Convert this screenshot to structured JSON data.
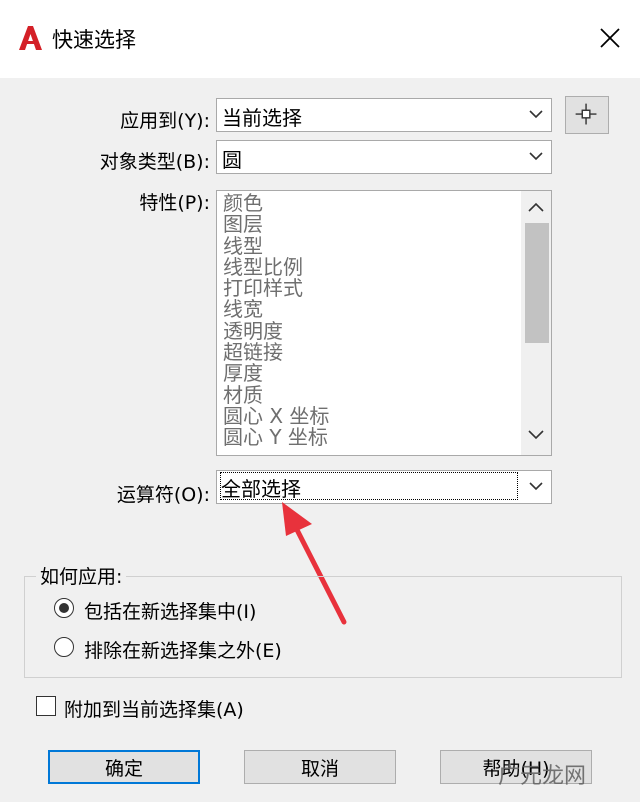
{
  "window": {
    "title": "快速选择"
  },
  "apply_to": {
    "label": "应用到(Y):",
    "value": "当前选择"
  },
  "object_type": {
    "label": "对象类型(B):",
    "value": "圆"
  },
  "properties": {
    "label": "特性(P):",
    "items": [
      "颜色",
      "图层",
      "线型",
      "线型比例",
      "打印样式",
      "线宽",
      "透明度",
      "超链接",
      "厚度",
      "材质",
      "圆心 X 坐标",
      "圆心 Y 坐标"
    ]
  },
  "operator": {
    "label": "运算符(O):",
    "value": "全部选择"
  },
  "how_to_apply": {
    "title": "如何应用:",
    "include_label": "包括在新选择集中(I)",
    "exclude_label": "排除在新选择集之外(E)",
    "selected": "include"
  },
  "append": {
    "label": "附加到当前选择集(A)",
    "checked": false
  },
  "buttons": {
    "ok": "确定",
    "cancel": "取消",
    "help": "帮助(H)"
  },
  "watermark": "广元龙网",
  "colors": {
    "annotation_arrow": "#e8323c",
    "focus_border": "#0078d7"
  }
}
